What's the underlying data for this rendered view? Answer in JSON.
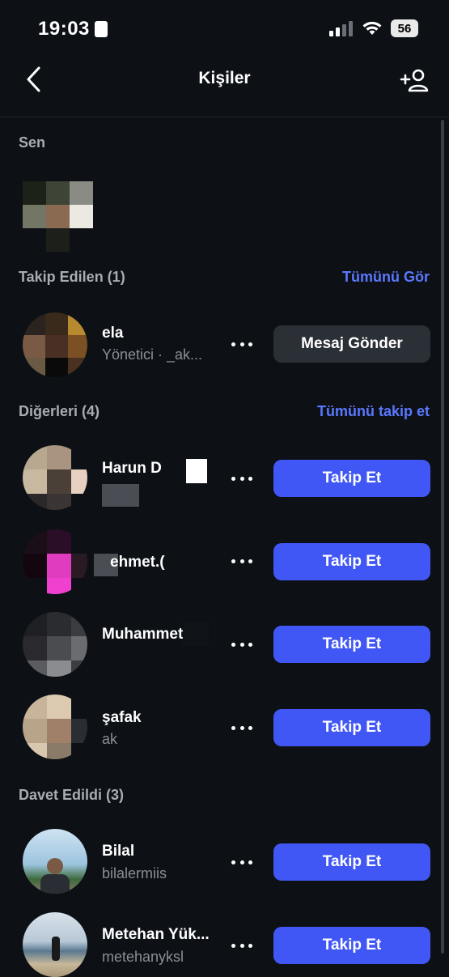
{
  "status": {
    "time": "19:03",
    "battery": "56"
  },
  "header": {
    "title": "Kişiler"
  },
  "sections": {
    "you": {
      "label": "Sen"
    },
    "following": {
      "label": "Takip Edilen (1)",
      "link": "Tümünü Gör"
    },
    "others": {
      "label": "Diğerleri (4)",
      "link": "Tümünü takip et"
    },
    "invited": {
      "label": "Davet Edildi (3)"
    }
  },
  "rows": [
    {
      "name": "ela",
      "sub": "Yönetici · _ak...",
      "button": "Mesaj Gönder"
    },
    {
      "name": "Harun D",
      "sub": "",
      "button": "Takip Et"
    },
    {
      "name": "ehmet.(",
      "sub": "",
      "button": "Takip Et"
    },
    {
      "name": "Muhammet",
      "sub": "",
      "button": "Takip Et"
    },
    {
      "name": "şafak",
      "sub": "ak",
      "button": "Takip Et"
    },
    {
      "name": "Bilal",
      "sub": "bilalermiis",
      "button": "Takip Et"
    },
    {
      "name": "Metehan Yük...",
      "sub": "metehanyksl",
      "button": "Takip Et"
    }
  ],
  "icons": {
    "back": "chevron-left-icon",
    "add": "add-user-icon",
    "more": "more-dots-icon",
    "signal": "signal-icon",
    "wifi": "wifi-icon",
    "battery": "battery-icon"
  },
  "colors": {
    "accent": "#4157f5",
    "link": "#5a78ff",
    "background": "#0d1116"
  }
}
